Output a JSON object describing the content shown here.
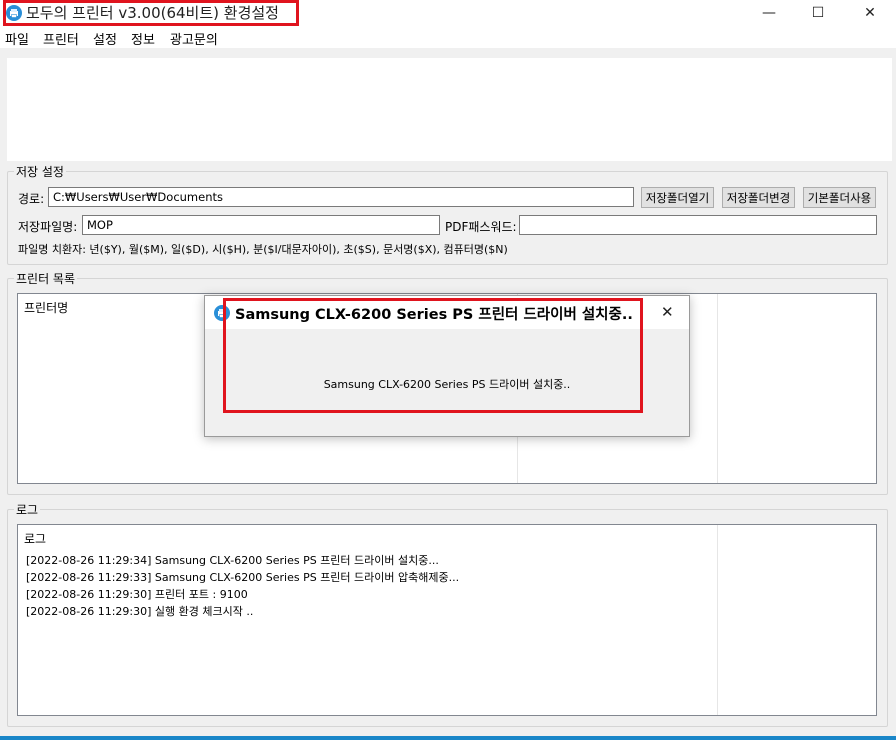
{
  "window": {
    "title": "모두의 프린터 v3.00(64비트) 환경설정",
    "minimize": "—",
    "maximize": "☐",
    "close": "✕"
  },
  "menu": [
    "파일",
    "프린터",
    "설정",
    "정보",
    "광고문의"
  ],
  "storage": {
    "legend": "저장 설정",
    "path_label": "경로:",
    "path_value": "C:₩Users₩User₩Documents",
    "open_folder": "저장폴더열기",
    "change_folder": "저장폴더변경",
    "default_folder": "기본폴더사용",
    "filename_label": "저장파일명:",
    "filename_value": "MOP",
    "pdf_password_label": "PDF패스워드:",
    "pdf_password_value": "",
    "substitution_text": "파일명 치환자: 년($Y), 월($M), 일($D), 시($H), 분($I/대문자아이), 초($S), 문서명($X), 컴퓨터명($N)"
  },
  "printers": {
    "legend": "프린터 목록",
    "column_header": "프린터명"
  },
  "log": {
    "legend": "로그",
    "column_header": "로그",
    "lines": [
      "[2022-08-26 11:29:34] Samsung CLX-6200 Series PS 프린터 드라이버 설치중...",
      "[2022-08-26 11:29:33] Samsung CLX-6200 Series PS 프린터 드라이버 압축해제중...",
      "[2022-08-26 11:29:30] 프린터 포트 : 9100",
      "[2022-08-26 11:29:30] 실행 환경 체크시작 .."
    ]
  },
  "dialog": {
    "title": "Samsung CLX-6200 Series PS 프린터 드라이버 설치중..",
    "message": "Samsung CLX-6200 Series PS 드라이버 설치중..",
    "close": "✕"
  },
  "colors": {
    "highlight": "#e0141e",
    "accent": "#1a86c8"
  }
}
